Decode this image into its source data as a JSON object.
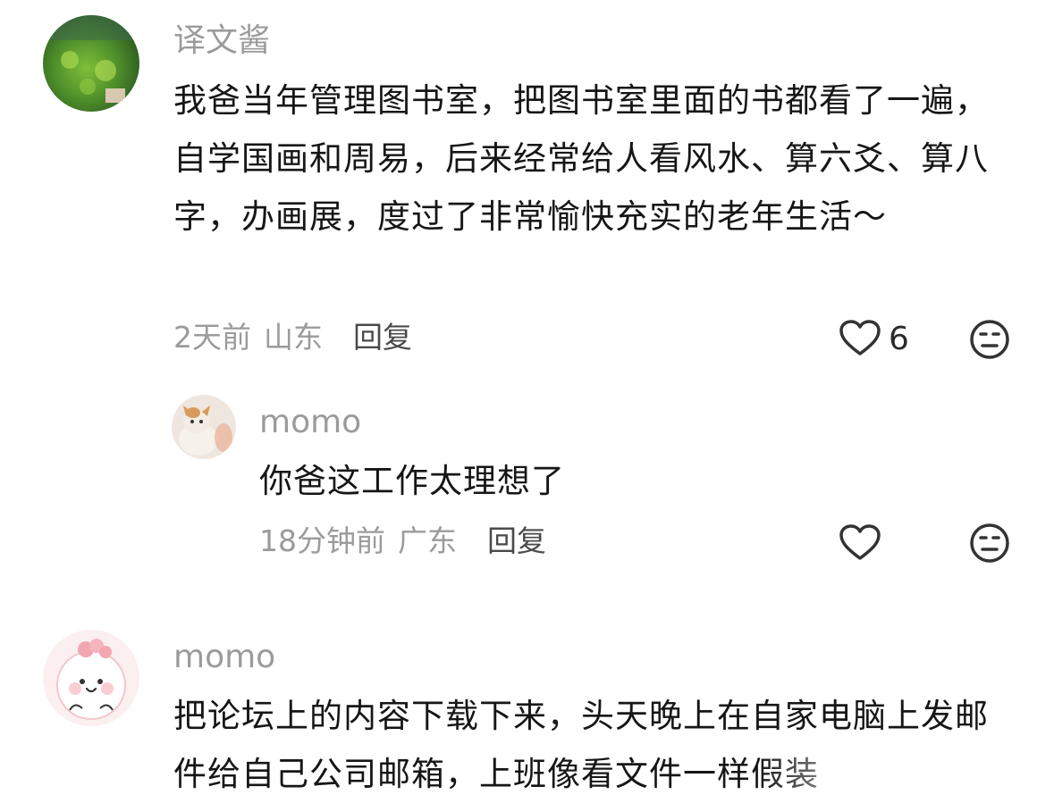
{
  "comments": [
    {
      "username": "译文酱",
      "text": "我爸当年管理图书室，把图书室里面的书都看了一遍，自学国画和周易，后来经常给人看风水、算六爻、算八字，办画展，度过了非常愉快充实的老年生活～",
      "time": "2天前",
      "location": "山东",
      "reply_label": "回复",
      "likes": "6",
      "avatar_icon": "pond-plants-photo",
      "replies": [
        {
          "username": "momo",
          "text": "你爸这工作太理想了",
          "time": "18分钟前",
          "location": "广东",
          "reply_label": "回复",
          "avatar_icon": "cat-photo"
        }
      ]
    },
    {
      "username": "momo",
      "text": "把论坛上的内容下载下来，头天晚上在自家电脑上发邮件给自己公司邮箱，上班像看文件一样假装",
      "avatar_icon": "cartoon-pink-character"
    }
  ],
  "icons": {
    "like": "heart-outline-icon",
    "dislike": "neutral-face-icon"
  },
  "colors": {
    "text": "#161616",
    "muted": "#9b9b9b",
    "reply": "#4a4a4a"
  }
}
